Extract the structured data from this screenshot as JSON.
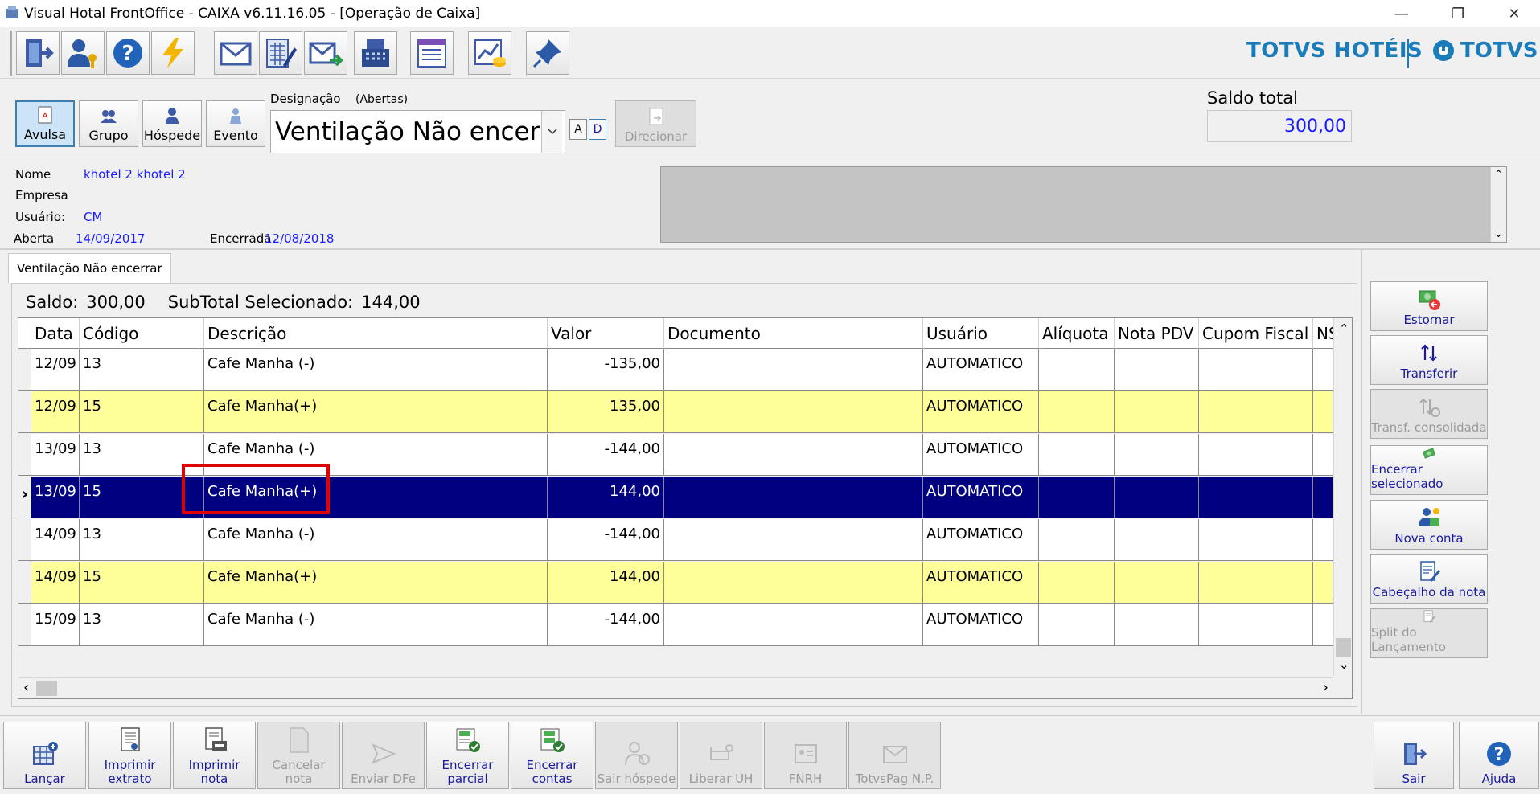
{
  "window": {
    "title": "Visual Hotal FrontOffice - CAIXA v6.11.16.05 - [Operação de Caixa]",
    "min": "—",
    "restore": "❐",
    "close": "✕"
  },
  "brand": {
    "left": "TOTVS HOTÉIS",
    "right": "TOTVS"
  },
  "account_types": [
    {
      "label": "Avulsa",
      "icon": "document-icon",
      "selected": true
    },
    {
      "label": "Grupo",
      "icon": "group-icon"
    },
    {
      "label": "Hóspede",
      "icon": "guest-icon"
    },
    {
      "label": "Evento",
      "icon": "event-icon"
    }
  ],
  "designation": {
    "label": "Designação",
    "filter": "(Abertas)",
    "value": "Ventilação Não encerrar",
    "btn_a": "A",
    "btn_d": "D",
    "direct": "Direcionar"
  },
  "balance": {
    "label": "Saldo total",
    "value": "300,00"
  },
  "info": {
    "nome_label": "Nome",
    "nome_value": "khotel 2 khotel 2",
    "empresa_label": "Empresa",
    "usuario_label": "Usuário:",
    "usuario_value": "CM",
    "aberta_label": "Aberta",
    "aberta_value": "14/09/2017",
    "encerrada_label": "Encerrada",
    "encerrada_value": "12/08/2018"
  },
  "tab": {
    "label": "Ventilação Não encerrar"
  },
  "summary": {
    "saldo_label": "Saldo:",
    "saldo_value": "300,00",
    "subtotal_label": "SubTotal Selecionado:",
    "subtotal_value": "144,00"
  },
  "grid": {
    "headers": [
      "Data",
      "Código",
      "Descrição",
      "Valor",
      "Documento",
      "Usuário",
      "Alíquota",
      "Nota PDV",
      "Cupom Fiscal",
      "NS"
    ],
    "rows": [
      {
        "data": "12/09",
        "codigo": "13",
        "descricao": "Cafe Manha (-)",
        "valor": "-135,00",
        "usuario": "AUTOMATICO",
        "style": "white"
      },
      {
        "data": "12/09",
        "codigo": "15",
        "descricao": "Cafe Manha(+)",
        "valor": "135,00",
        "usuario": "AUTOMATICO",
        "style": "yellow"
      },
      {
        "data": "13/09",
        "codigo": "13",
        "descricao": "Cafe Manha (-)",
        "valor": "-144,00",
        "usuario": "AUTOMATICO",
        "style": "white"
      },
      {
        "data": "13/09",
        "codigo": "15",
        "descricao": "Cafe Manha(+)",
        "valor": "144,00",
        "usuario": "AUTOMATICO",
        "style": "sel"
      },
      {
        "data": "14/09",
        "codigo": "13",
        "descricao": "Cafe Manha (-)",
        "valor": "-144,00",
        "usuario": "AUTOMATICO",
        "style": "white"
      },
      {
        "data": "14/09",
        "codigo": "15",
        "descricao": "Cafe Manha(+)",
        "valor": "144,00",
        "usuario": "AUTOMATICO",
        "style": "yellow"
      },
      {
        "data": "15/09",
        "codigo": "13",
        "descricao": "Cafe Manha (-)",
        "valor": "-144,00",
        "usuario": "AUTOMATICO",
        "style": "white"
      }
    ],
    "row_indicator": "›",
    "scroll_up": "⌃",
    "scroll_down": "⌄",
    "scroll_left": "‹",
    "scroll_right": "›"
  },
  "side_actions": [
    {
      "label": "Estornar",
      "icon": "reverse-money-icon",
      "enabled": true
    },
    {
      "label": "Transferir",
      "icon": "transfer-arrows-icon",
      "enabled": true
    },
    {
      "label": "Transf. consolidada",
      "icon": "consolidated-transfer-icon",
      "enabled": false
    },
    {
      "label": "Encerrar selecionado",
      "icon": "close-selected-icon",
      "enabled": true
    },
    {
      "label": "Nova conta",
      "icon": "new-account-icon",
      "enabled": true
    },
    {
      "label": "Cabeçalho da nota",
      "icon": "note-header-icon",
      "enabled": true
    },
    {
      "label": "Split do Lançamento",
      "icon": "split-entry-icon",
      "enabled": false
    }
  ],
  "bottom_actions": [
    {
      "label": "Lançar",
      "icon": "post-entry-icon",
      "enabled": true
    },
    {
      "label": "Imprimir extrato",
      "icon": "print-statement-icon",
      "enabled": true
    },
    {
      "label": "Imprimir nota",
      "icon": "print-note-icon",
      "enabled": true
    },
    {
      "label": "Cancelar nota",
      "icon": "cancel-note-icon",
      "enabled": false
    },
    {
      "label": "Enviar DFe",
      "icon": "send-dfe-icon",
      "enabled": false
    },
    {
      "label": "Encerrar parcial",
      "icon": "close-partial-icon",
      "enabled": true
    },
    {
      "label": "Encerrar contas",
      "icon": "close-accounts-icon",
      "enabled": true
    },
    {
      "label": "Sair hóspede",
      "icon": "checkout-guest-icon",
      "enabled": false
    },
    {
      "label": "Liberar UH",
      "icon": "release-room-icon",
      "enabled": false
    },
    {
      "label": "FNRH",
      "icon": "fnrh-icon",
      "enabled": false
    },
    {
      "label": "TotvsPag N.P.",
      "icon": "totvspag-icon",
      "enabled": false
    },
    {
      "label": "Sair",
      "icon": "exit-icon",
      "enabled": true
    },
    {
      "label": "Ajuda",
      "icon": "help-icon",
      "enabled": true
    }
  ],
  "toolbar": [
    "exit-door-icon",
    "user-key-icon",
    "help-icon",
    "lightning-icon",
    "envelope-icon",
    "calculator-pen-icon",
    "send-mail-icon",
    "cash-register-icon",
    "report-icon",
    "chart-coins-icon",
    "pin-icon"
  ],
  "colors": {
    "selected_row": "#000080",
    "alt_row": "#ffff99",
    "link_blue": "#1a1aff",
    "brand": "#1a7cb8",
    "highlight": "#e00000"
  }
}
